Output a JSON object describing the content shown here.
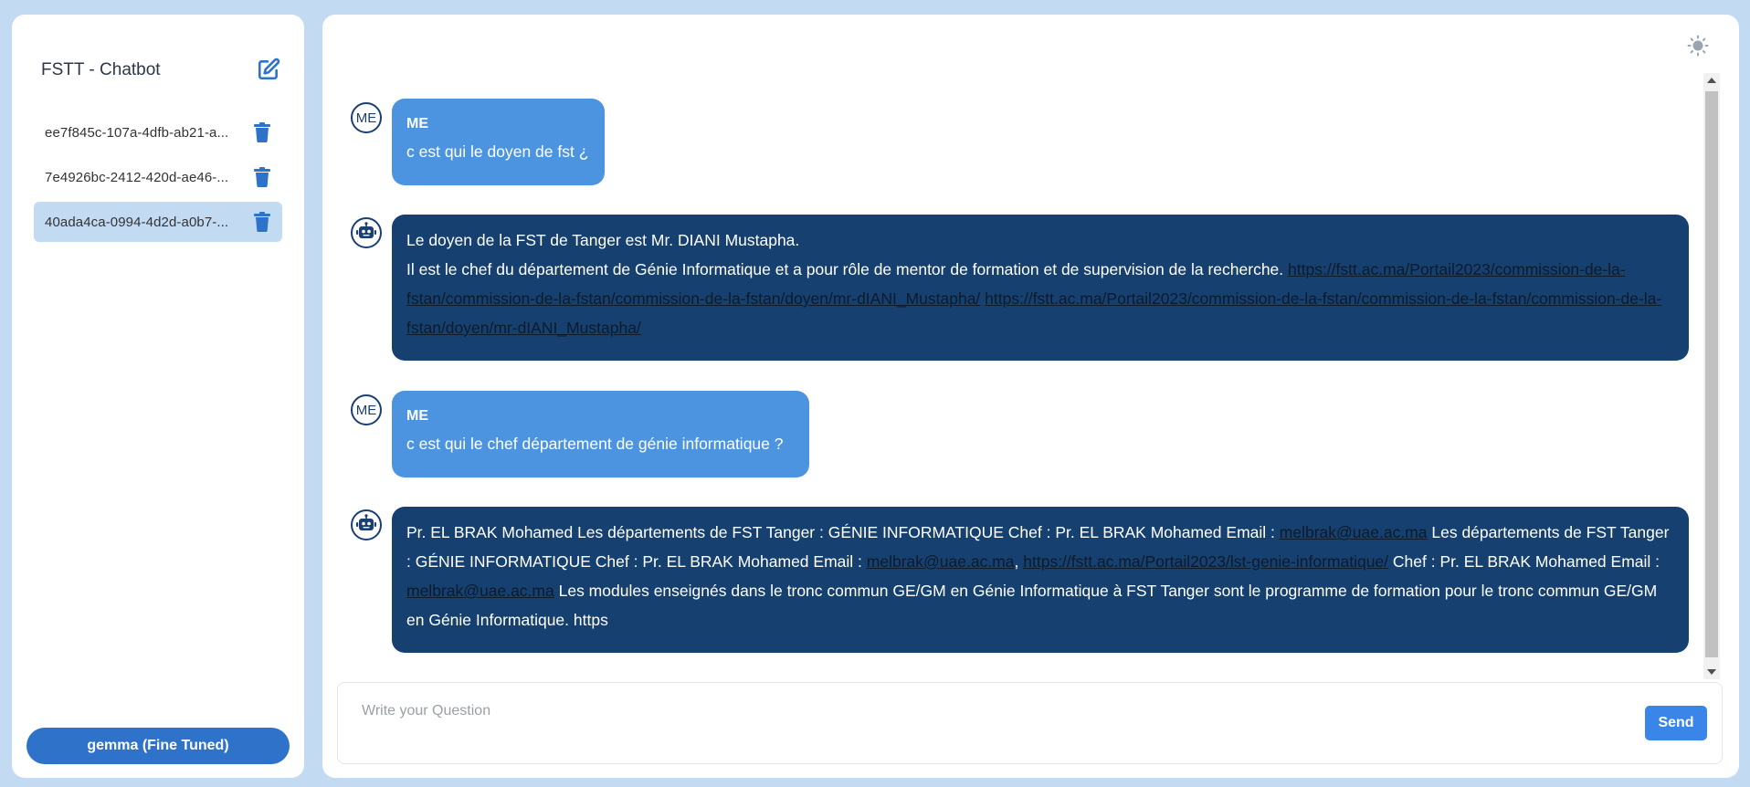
{
  "sidebar": {
    "title": "FSTT - Chatbot",
    "conversations": [
      {
        "label": "ee7f845c-107a-4dfb-ab21-a..."
      },
      {
        "label": "7e4926bc-2412-420d-ae46-..."
      },
      {
        "label": "40ada4ca-0994-4d2d-a0b7-..."
      }
    ],
    "model_button": "gemma (Fine Tuned)"
  },
  "chat": {
    "user_avatar": "ME",
    "messages": [
      {
        "sender": "ME",
        "text": "c est qui le doyen de fst ¿"
      },
      {
        "line1": "Le doyen de la FST de Tanger est Mr. DIANI Mustapha.",
        "line2": "Il est le chef du département de Génie Informatique et a pour rôle de mentor de formation et de supervision de la recherche.",
        "link1": "https://fstt.ac.ma/Portail2023/commission-de-la-fstan/commission-de-la-fstan/commission-de-la-fstan/doyen/mr-dIANI_Mustapha/",
        "link2": "https://fstt.ac.ma/Portail2023/commission-de-la-fstan/commission-de-la-fstan/commission-de-la-fstan/doyen/mr-dIANI_Mustapha/"
      },
      {
        "sender": "ME",
        "text": "c est qui le chef département de génie informatique ?"
      },
      {
        "t1": "Pr. EL BRAK Mohamed Les départements de FST Tanger : GÉNIE INFORMATIQUE Chef : Pr. EL BRAK Mohamed Email :",
        "email1": "melbrak@uae.ac.ma",
        "t2": "Les départements de FST Tanger : GÉNIE INFORMATIQUE Chef : Pr. EL BRAK Mohamed Email :",
        "email2": "melbrak@uae.ac.ma",
        "sep": ",",
        "link": "https://fstt.ac.ma/Portail2023/lst-genie-informatique/",
        "t3": "Chef : Pr. EL BRAK Mohamed Email :",
        "email3": "melbrak@uae.ac.ma",
        "t4": "Les modules enseignés dans le tronc commun GE/GM en Génie Informatique à FST Tanger sont le programme de formation pour le tronc commun GE/GM en Génie Informatique. https"
      }
    ]
  },
  "input": {
    "placeholder": "Write your Question",
    "value": "",
    "send_label": "Send"
  },
  "colors": {
    "page_bg": "#c3daf3",
    "user_bubble": "#4d94e0",
    "bot_bubble": "#16406f",
    "accent": "#2e73c9"
  }
}
